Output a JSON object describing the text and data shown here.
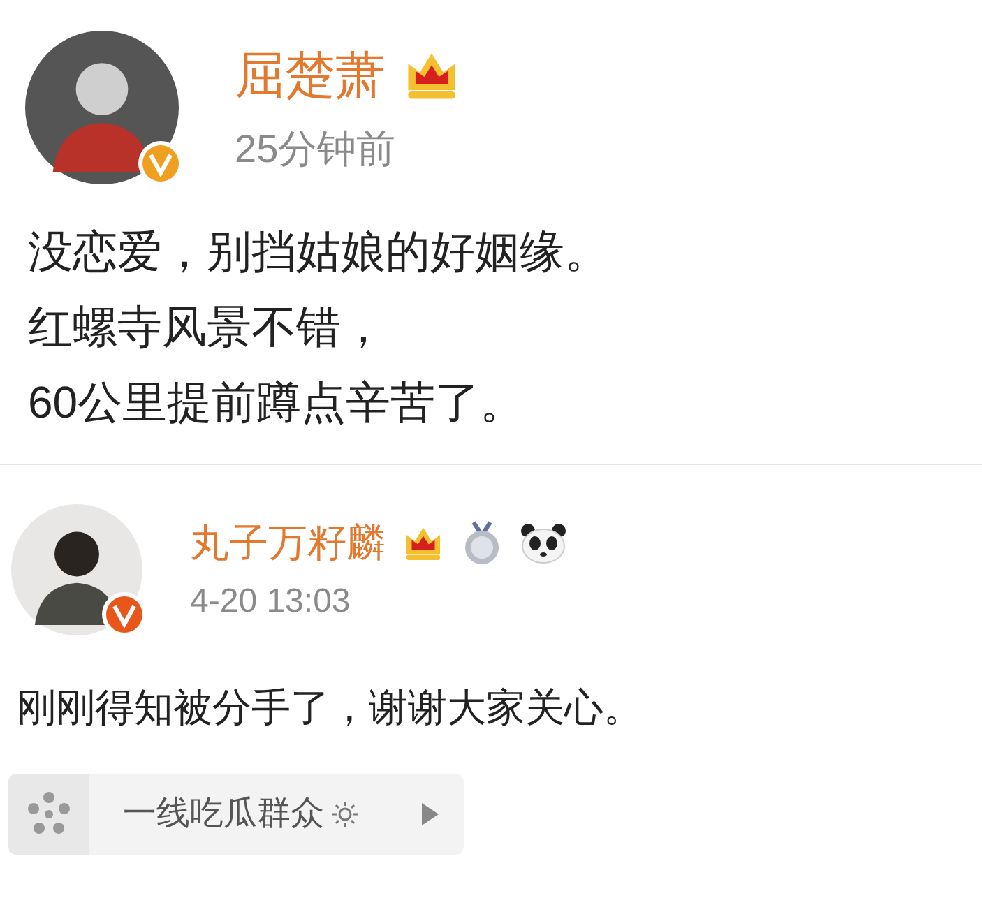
{
  "posts": [
    {
      "name": "屈楚萧",
      "time": "25分钟前",
      "lines": [
        "没恋爱，别挡姑娘的好姻缘。",
        "红螺寺风景不错，",
        "60公里提前蹲点辛苦了。"
      ]
    },
    {
      "name": "丸子万籽麟",
      "time": "4-20 13:03",
      "lines": [
        "刚刚得知被分手了，谢谢大家关心。"
      ]
    }
  ],
  "topic_card": {
    "label": "一线吃瓜群众"
  }
}
